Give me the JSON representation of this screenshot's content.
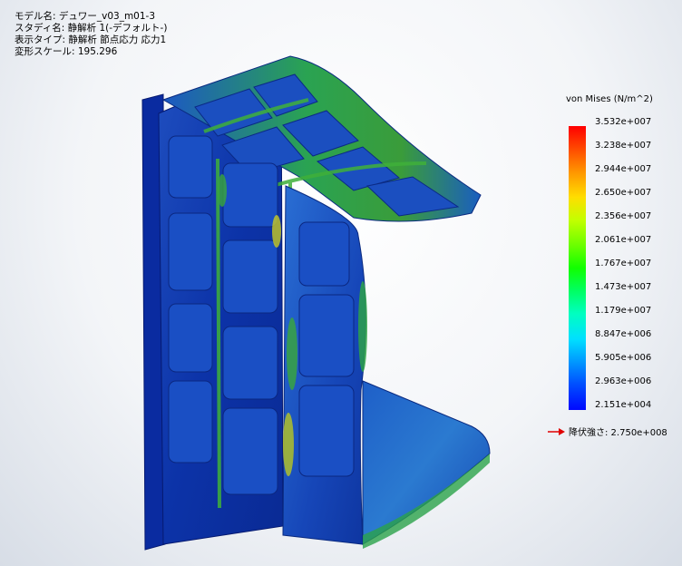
{
  "header": {
    "model_name": "モデル名: デュワー_v03_m01-3",
    "study_name": "スタディ名: 静解析 1(-デフォルト-)",
    "plot_type": "表示タイプ: 静解析 節点応力 応力1",
    "deform_scale": "変形スケール: 195.296"
  },
  "legend": {
    "title": "von Mises (N/m^2)",
    "labels": [
      "3.532e+007",
      "3.238e+007",
      "2.944e+007",
      "2.650e+007",
      "2.356e+007",
      "2.061e+007",
      "1.767e+007",
      "1.473e+007",
      "1.179e+007",
      "8.847e+006",
      "5.905e+006",
      "2.963e+006",
      "2.151e+004"
    ],
    "yield_strength": "降伏強さ: 2.750e+008"
  },
  "colors": {
    "part_dark_blue": "#0a2aa8",
    "part_blue": "#1a56c8",
    "stress_green": "#2fa83a",
    "stress_yellow": "#c9d21a",
    "arrow_red": "#e00000"
  }
}
